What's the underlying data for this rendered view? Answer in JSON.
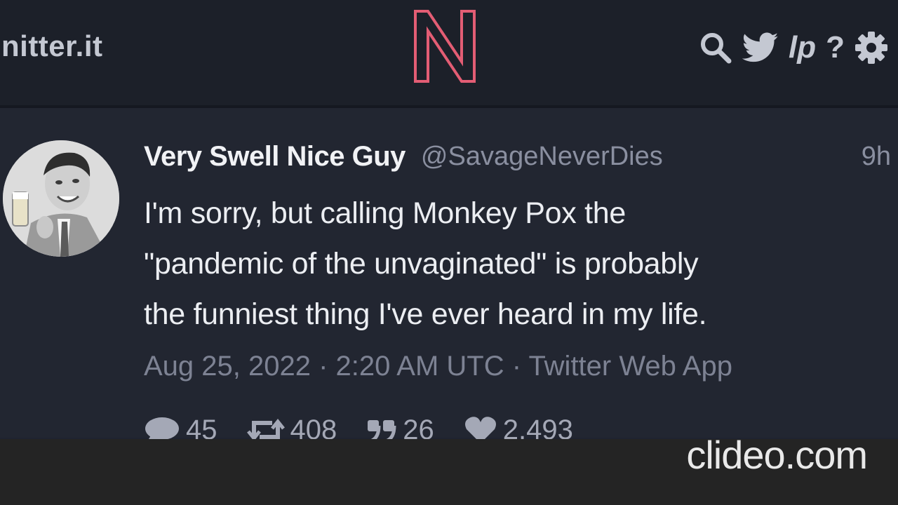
{
  "navbar": {
    "site_name": "nitter.it",
    "logo_letter": "N",
    "logo_color": "#e35d74",
    "icons": [
      "search-icon",
      "twitter-bird-icon",
      "lp-icon",
      "help-icon",
      "gear-icon"
    ],
    "lp_label": "lp",
    "help_label": "?"
  },
  "tweet": {
    "fullname": "Very Swell Nice Guy",
    "username": "@SavageNeverDies",
    "time_ago": "9h",
    "body_lines": [
      "I'm sorry, but calling Monkey Pox the",
      "\"pandemic of the unvaginated\" is probably",
      "the funniest thing I've ever heard in my life."
    ],
    "published": "Aug 25, 2022 · 2:20 AM UTC · Twitter Web App",
    "stats": {
      "replies": "45",
      "retweets": "408",
      "quotes": "26",
      "likes": "2,493"
    }
  },
  "watermark": "clideo.com"
}
